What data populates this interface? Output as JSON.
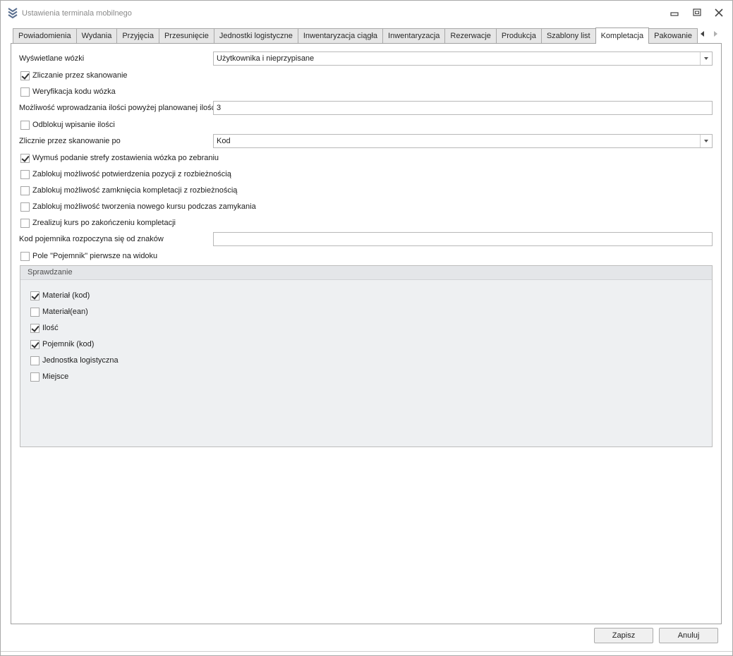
{
  "window": {
    "title": "Ustawienia terminala mobilnego",
    "accent": "#5a6f90"
  },
  "tabs": [
    {
      "label": "Powiadomienia",
      "active": false
    },
    {
      "label": "Wydania",
      "active": false
    },
    {
      "label": "Przyjęcia",
      "active": false
    },
    {
      "label": "Przesunięcie",
      "active": false
    },
    {
      "label": "Jednostki logistyczne",
      "active": false
    },
    {
      "label": "Inwentaryzacja ciągła",
      "active": false
    },
    {
      "label": "Inwentaryzacja",
      "active": false
    },
    {
      "label": "Rezerwacje",
      "active": false
    },
    {
      "label": "Produkcja",
      "active": false
    },
    {
      "label": "Szablony list",
      "active": false
    },
    {
      "label": "Kompletacja",
      "active": true
    },
    {
      "label": "Pakowanie",
      "active": false
    }
  ],
  "form": {
    "displayed_carts_label": "Wyświetlane wózki",
    "displayed_carts_value": "Użytkownika i nieprzypisane",
    "count_by_scan_label": "Zliczanie przez skanowanie",
    "count_by_scan_checked": true,
    "verify_cart_code_label": "Weryfikacja kodu wózka",
    "verify_cart_code_checked": false,
    "over_planned_label": "Możliwość wprowadzania ilości powyżej planowanej ilości",
    "over_planned_value": "3",
    "unlock_qty_label": "Odblokuj wpisanie ilości",
    "unlock_qty_checked": false,
    "count_scan_by_label": "Zlicznie przez skanowanie po",
    "count_scan_by_value": "Kod",
    "force_zone_label": "Wymuś podanie strefy zostawienia wózka po zebraniu",
    "force_zone_checked": true,
    "block_confirm_label": "Zablokuj możliwość potwierdzenia pozycji z rozbieżnością",
    "block_confirm_checked": false,
    "block_close_label": "Zablokuj możliwość zamknięcia kompletacji z rozbieżnością",
    "block_close_checked": false,
    "block_new_course_label": "Zablokuj możliwość tworzenia nowego kursu podczas zamykania",
    "block_new_course_checked": false,
    "realize_course_label": "Zrealizuj kurs po zakończeniu kompletacji",
    "realize_course_checked": false,
    "container_code_label": "Kod pojemnika rozpoczyna się od znaków",
    "container_code_value": "",
    "container_first_label": "Pole \"Pojemnik\" pierwsze na widoku",
    "container_first_checked": false
  },
  "group": {
    "title": "Sprawdzanie",
    "items": [
      {
        "label": "Materiał (kod)",
        "checked": true
      },
      {
        "label": "Materiał(ean)",
        "checked": false
      },
      {
        "label": "Ilość",
        "checked": true
      },
      {
        "label": "Pojemnik (kod)",
        "checked": true
      },
      {
        "label": "Jednostka logistyczna",
        "checked": false
      },
      {
        "label": "Miejsce",
        "checked": false
      }
    ]
  },
  "buttons": {
    "save_label": "Zapisz",
    "cancel_label": "Anuluj"
  }
}
